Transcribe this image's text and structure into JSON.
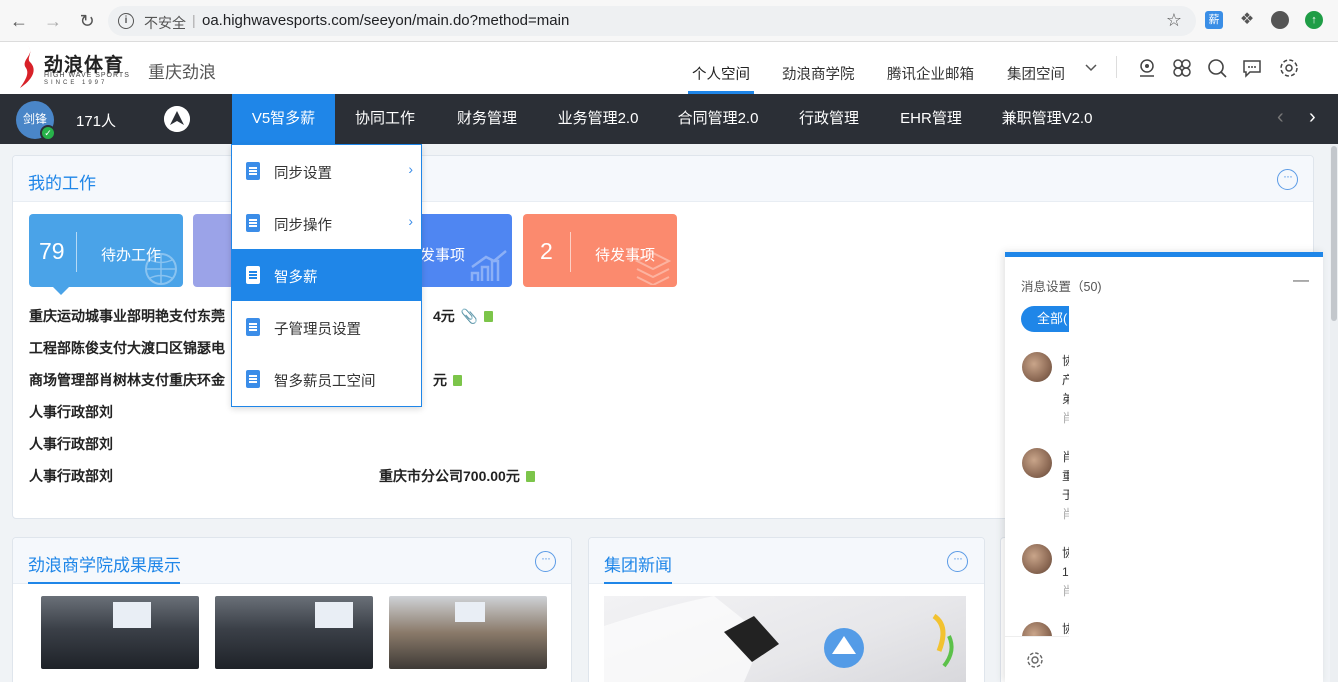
{
  "browser": {
    "insecure_label": "不安全",
    "url": "oa.highwavesports.com/seeyon/main.do?method=main",
    "ext_label": "薪"
  },
  "header": {
    "logo_cn": "劲浪体育",
    "logo_en": "HIGH WAVE SPORTS",
    "logo_since": "SINCE 1997",
    "company": "重庆劲浪",
    "tabs": [
      "个人空间",
      "劲浪商学院",
      "腾讯企业邮箱",
      "集团空间"
    ],
    "icons": [
      "location-icon",
      "apps-icon",
      "search-icon",
      "chat-icon",
      "gear-icon"
    ]
  },
  "navbar": {
    "avatar_text": "剑锋",
    "online_count": "171人",
    "items": [
      "V5智多薪",
      "协同工作",
      "财务管理",
      "业务管理2.0",
      "合同管理2.0",
      "行政管理",
      "EHR管理",
      "兼职管理V2.0"
    ]
  },
  "dropdown": {
    "items": [
      "同步设置",
      "同步操作",
      "智多薪",
      "子管理员设置",
      "智多薪员工空间"
    ]
  },
  "my_work": {
    "title": "我的工作",
    "cards": [
      {
        "num": "79",
        "label": "待办工作",
        "color": "#4aa3e8"
      },
      {
        "num": "",
        "label": "",
        "color": "#9ba3e8"
      },
      {
        "num": "",
        "label": "发事项",
        "color": "#4f86f2"
      },
      {
        "num": "2",
        "label": "待发事项",
        "color": "#fb8a6e"
      }
    ],
    "rows": [
      {
        "text": "重庆运动城事业部明艳支付东莞",
        "tail": "4元"
      },
      {
        "text": "工程部陈俊支付大渡口区锦瑟电",
        "tail": ""
      },
      {
        "text": "商场管理部肖树林支付重庆环金",
        "tail": "元"
      },
      {
        "text": "人事行政部刘",
        "tail": ""
      },
      {
        "text": "人事行政部刘",
        "tail": ""
      },
      {
        "text": "人事行政部刘",
        "tail": "重庆市分公司700.00元"
      }
    ]
  },
  "academy": {
    "title": "劲浪商学院成果展示"
  },
  "news": {
    "title": "集团新闻"
  },
  "messages": {
    "title": "消息设置（50)",
    "tab_all": "全部(",
    "items": [
      {
        "lines": [
          "协",
          "产",
          "弟",
          "肖"
        ]
      },
      {
        "lines": [
          "肖",
          "重",
          "于",
          "肖"
        ]
      },
      {
        "lines": [
          "协",
          "1",
          "肖"
        ]
      },
      {
        "lines": [
          "协"
        ]
      }
    ]
  }
}
